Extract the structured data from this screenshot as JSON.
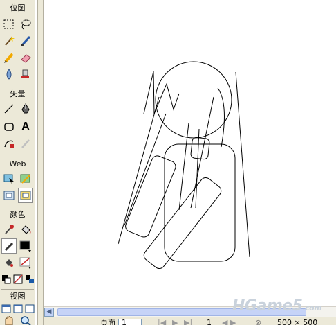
{
  "toolbox": {
    "sections": {
      "bitmap": "位图",
      "vector": "矢量",
      "web": "Web",
      "colors": "颜色",
      "view": "视图"
    },
    "text_tool_glyph": "A"
  },
  "status_bar": {
    "page_label": "页面",
    "page_value": "1",
    "frame_value": "1",
    "canvas_size": "500 × 500"
  },
  "watermark": "HGame5",
  "watermark_suffix": ".com",
  "colors": {
    "stroke": "#000000",
    "fill": "#000000",
    "accent": "#c62828"
  }
}
